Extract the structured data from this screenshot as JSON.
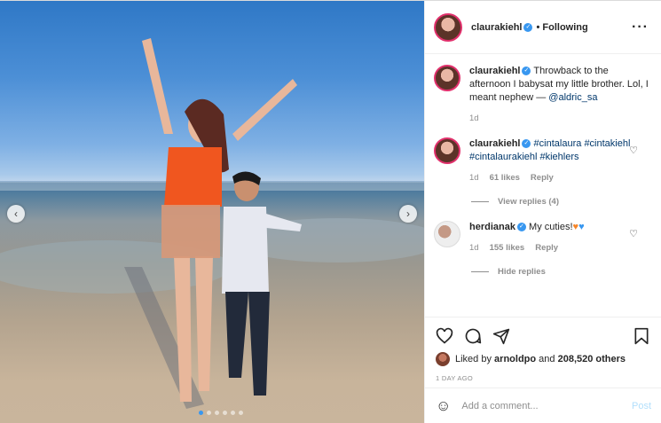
{
  "post": {
    "username": "claurakiehl",
    "follow_status": "Following",
    "more_icon": "more-horizontal-icon"
  },
  "caption": {
    "username": "claurakiehl",
    "text": "Throwback to the afternoon I babysat my little brother. Lol, I meant nephew —",
    "mention": "@aldric_sa",
    "time": "1d"
  },
  "comments": [
    {
      "username": "claurakiehl",
      "tags": [
        "#cintalaura",
        "#cintakiehl",
        "#cintalaurakiehl",
        "#kiehlers"
      ],
      "time": "1d",
      "likes": "61 likes",
      "reply_label": "Reply",
      "view_replies": "View replies (4)"
    },
    {
      "username": "herdianak",
      "text": "My cuties!",
      "emojis": [
        "orange-heart",
        "blue-heart"
      ],
      "time": "1d",
      "likes": "155 likes",
      "reply_label": "Reply",
      "hide_replies": "Hide replies"
    }
  ],
  "likes": {
    "liked_by_prefix": "Liked by",
    "liked_by_user": "arnoldpo",
    "and_text": "and",
    "others": "208,520 others"
  },
  "timestamp": "1 DAY AGO",
  "comment_box": {
    "placeholder": "Add a comment...",
    "post_label": "Post"
  },
  "carousel": {
    "slide_count": 6,
    "active_index": 0
  },
  "colors": {
    "verified": "#3897f0",
    "link": "#00376b",
    "muted": "#8e8e8e",
    "post_disabled": "#b2dffc"
  }
}
